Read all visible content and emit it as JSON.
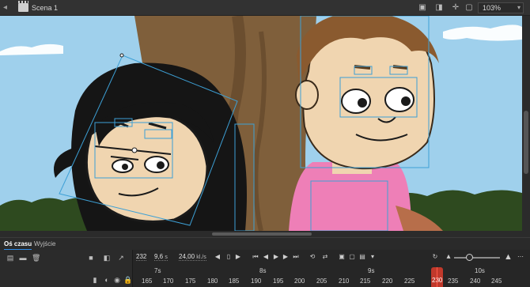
{
  "scene_bar": {
    "scene_name": "Scena 1",
    "zoom": "103%",
    "icons": [
      "back-arrow-icon",
      "clapperboard-icon",
      "edit-symbols-icon",
      "stage-clip-icon",
      "center-stage-icon",
      "fit-icon"
    ]
  },
  "panel": {
    "tabs": [
      "Oś czasu",
      "Wyjście"
    ],
    "active_tab": "Oś czasu"
  },
  "timeline": {
    "current_frame": "232",
    "elapsed": "9,6",
    "elapsed_unit": "s",
    "fps": "24,00",
    "fps_unit": "kl./s",
    "second_markers": [
      "7s",
      "8s",
      "9s",
      "10s"
    ],
    "frame_numbers": [
      "165",
      "170",
      "175",
      "180",
      "185",
      "190",
      "195",
      "200",
      "205",
      "210",
      "215",
      "220",
      "225",
      "230",
      "235",
      "240",
      "245"
    ],
    "playhead_label": "230"
  },
  "colors": {
    "sky": "#9fd0ec",
    "accent": "#2d8ceb",
    "playhead": "#c1392b",
    "shirt": "#ee7fb7",
    "skin": "#f0d5b0",
    "tree": "#7f5f3b"
  }
}
